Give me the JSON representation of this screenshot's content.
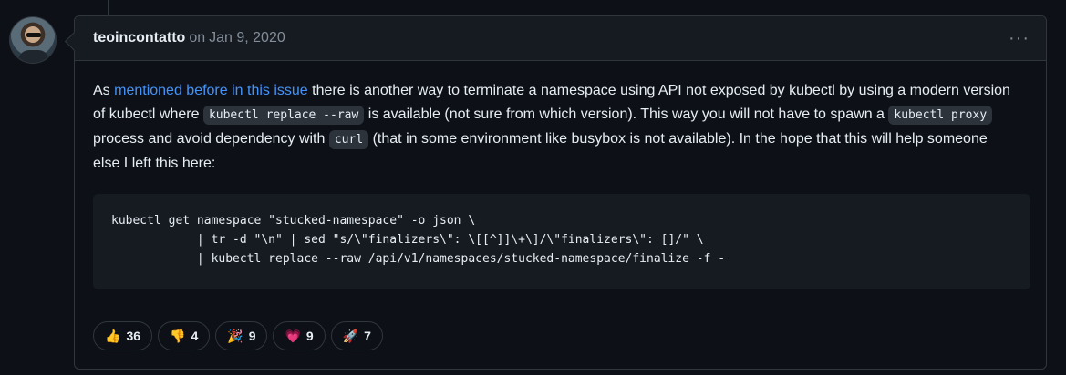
{
  "comment": {
    "author": "teoincontatto",
    "on_text": "on",
    "timestamp": "Jan 9, 2020",
    "more_label": "···",
    "body": {
      "p1": "As ",
      "link": "mentioned before in this issue",
      "p2": " there is another way to terminate a namespace using API not exposed by kubectl by using a modern version of kubectl where ",
      "code1": "kubectl replace --raw",
      "p3": " is available (not sure from which version). This way you will not have to spawn a ",
      "code2": "kubectl proxy",
      "p4": " process and avoid dependency with ",
      "code3": "curl",
      "p5": " (that in some environment like busybox is not available). In the hope that this will help someone else I left this here:"
    },
    "code_block": [
      "kubectl get namespace \"stucked-namespace\" -o json \\",
      "            | tr -d \"\\n\" | sed \"s/\\\"finalizers\\\": \\[[^]]\\+\\]/\\\"finalizers\\\": []/\" \\",
      "            | kubectl replace --raw /api/v1/namespaces/stucked-namespace/finalize -f -"
    ]
  },
  "reactions": [
    {
      "emoji": "👍",
      "icon": "thumbs-up-icon",
      "count": "36"
    },
    {
      "emoji": "👎",
      "icon": "thumbs-down-icon",
      "count": "4"
    },
    {
      "emoji": "🎉",
      "icon": "tada-icon",
      "count": "9"
    },
    {
      "emoji": "💗",
      "icon": "heart-icon",
      "count": "9"
    },
    {
      "emoji": "🚀",
      "icon": "rocket-icon",
      "count": "7"
    }
  ]
}
